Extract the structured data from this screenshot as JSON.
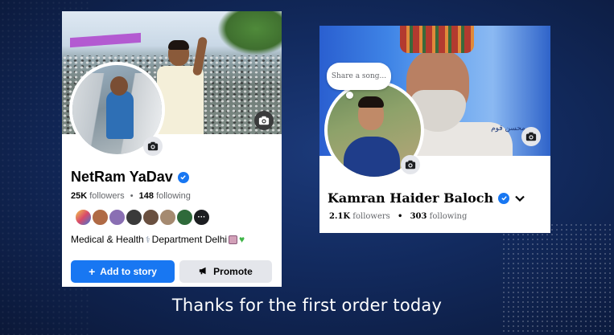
{
  "profile_card_1": {
    "name": "NetRam YaDav",
    "followers_count": "25K",
    "followers_label": "followers",
    "separator": "•",
    "following_count": "148",
    "following_label": "following",
    "bio": "Medical & Health",
    "bio_continued": "Department Delhi",
    "bio_emoji_icons": [
      "stethoscope-icon",
      "hospital-icon",
      "green-heart-icon"
    ],
    "more_friends_label": "···",
    "add_to_story_label": "Add to story",
    "promote_label": "Promote",
    "colors": {
      "accent": "#1877f2",
      "secondary_button": "#e4e6eb"
    }
  },
  "profile_card_2": {
    "note_placeholder": "Share a song...",
    "name": "Kamran Haider Baloch",
    "followers_count": "2.1K",
    "followers_label": "followers",
    "separator": "•",
    "following_count": "303",
    "following_label": "following",
    "cover_text": "محسن قوم"
  },
  "caption": "Thanks for the first order today"
}
